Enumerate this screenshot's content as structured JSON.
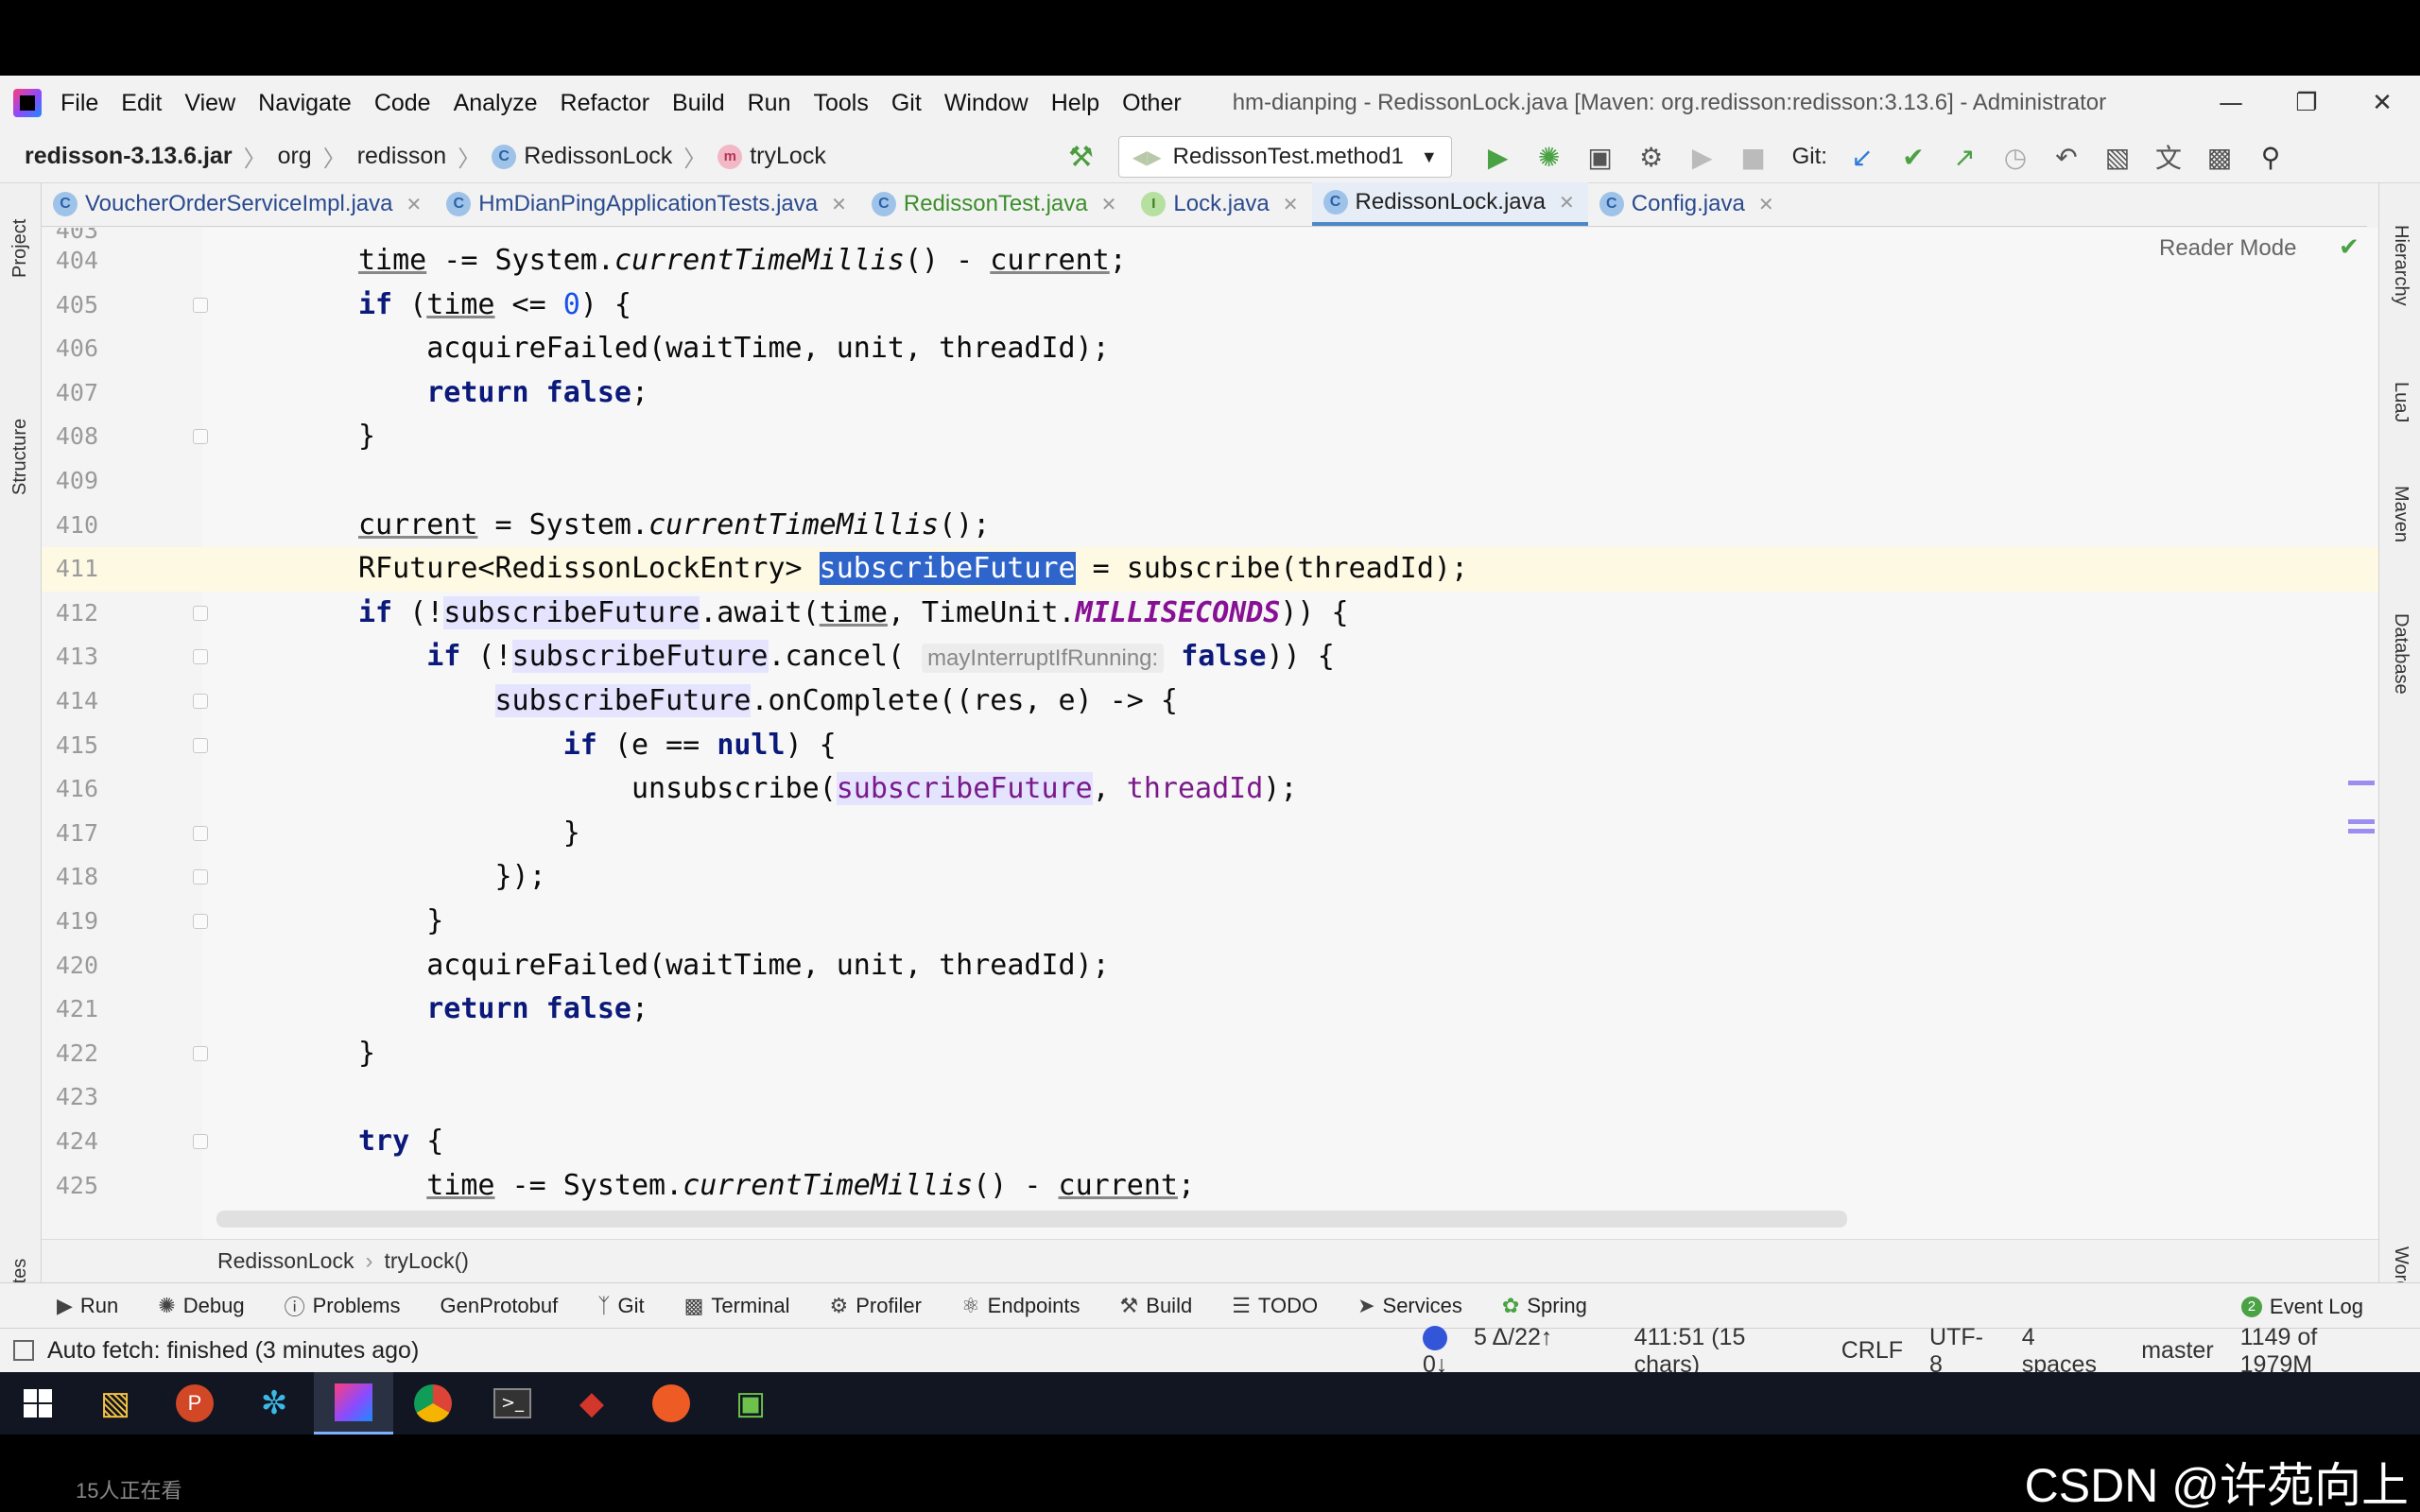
{
  "menu": {
    "items": [
      "File",
      "Edit",
      "View",
      "Navigate",
      "Code",
      "Analyze",
      "Refactor",
      "Build",
      "Run",
      "Tools",
      "Git",
      "Window",
      "Help",
      "Other"
    ],
    "window_title": "hm-dianping - RedissonLock.java [Maven: org.redisson:redisson:3.13.6] - Administrator"
  },
  "nav": {
    "jar": "redisson-3.13.6.jar",
    "pkg1": "org",
    "pkg2": "redisson",
    "class": "RedissonLock",
    "method": "tryLock",
    "run_config": "RedissonTest.method1",
    "git_label": "Git:"
  },
  "tabs": [
    {
      "label": "VoucherOrderServiceImpl.java",
      "icon": "C"
    },
    {
      "label": "HmDianPingApplicationTests.java",
      "icon": "C"
    },
    {
      "label": "RedissonTest.java",
      "icon": "C"
    },
    {
      "label": "Lock.java",
      "icon": "I"
    },
    {
      "label": "RedissonLock.java",
      "icon": "C"
    },
    {
      "label": "Config.java",
      "icon": "C"
    }
  ],
  "left_tools": [
    "Project",
    "Structure",
    "Favorites"
  ],
  "right_tools": [
    "Hierarchy",
    "LuaJ",
    "Maven",
    "Database",
    "Word Book"
  ],
  "editor": {
    "reader_mode": "Reader Mode",
    "partial_line_number": "403",
    "line_numbers": [
      "404",
      "405",
      "406",
      "407",
      "408",
      "409",
      "410",
      "411",
      "412",
      "413",
      "414",
      "415",
      "416",
      "417",
      "418",
      "419",
      "420",
      "421",
      "422",
      "423",
      "424",
      "425"
    ],
    "param_hint": "mayInterruptIfRunning:"
  },
  "bottom_crumb": {
    "class": "RedissonLock",
    "method": "tryLock()"
  },
  "tool_windows": [
    "Run",
    "Debug",
    "Problems",
    "GenProtobuf",
    "Git",
    "Terminal",
    "Profiler",
    "Endpoints",
    "Build",
    "TODO",
    "Services",
    "Spring"
  ],
  "event_log": {
    "label": "Event Log",
    "count": "2"
  },
  "status": {
    "message": "Auto fetch: finished (3 minutes ago)",
    "git_changes": "5 Δ/22↑ 0↓",
    "position": "411:51 (15 chars)",
    "line_sep": "CRLF",
    "encoding": "UTF-8",
    "indent": "4 spaces",
    "branch": "master",
    "memory": "1149 of 1979M"
  },
  "viewers": "15人正在看",
  "watermark": "CSDN @许苑向上",
  "colors": {
    "selection": "#2f65ca",
    "keyword": "#0b1a7a",
    "current_line": "#fdf9e3"
  }
}
